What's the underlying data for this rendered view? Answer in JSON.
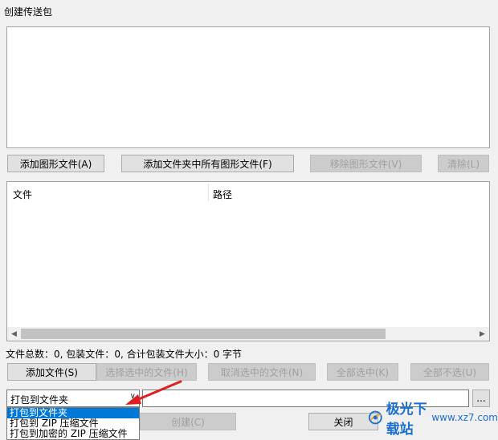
{
  "window": {
    "title": "创建传送包"
  },
  "buttons": {
    "add_graphic": "添加图形文件(A)",
    "add_folder_graphics": "添加文件夹中所有图形文件(F)",
    "remove_graphic": "移除图形文件(V)",
    "clear": "清除(L)",
    "add_file": "添加文件(S)",
    "select_chosen": "选择选中的文件(H)",
    "deselect_chosen": "取消选中的文件(N)",
    "select_all": "全部选中(K)",
    "select_none": "全部不选(U)",
    "create": "创建(C)",
    "close": "关闭",
    "browse": "..."
  },
  "file_list": {
    "columns": [
      "文件",
      "路径"
    ],
    "rows": []
  },
  "summary": {
    "total_label": "文件总数：",
    "total_value": "0",
    "packaged_label": "包装文件：",
    "packaged_value": "0",
    "size_label": "合计包装文件大小：",
    "size_value": "0 字节"
  },
  "package_mode": {
    "selected": "打包到文件夹",
    "options": [
      "打包到文件夹",
      "打包到 ZIP 压缩文件",
      "打包到加密的 ZIP 压缩文件"
    ],
    "highlighted_index": 0
  },
  "output_path": {
    "value": ""
  },
  "watermark": {
    "name": "极光下载站",
    "url": "www.xz7.com"
  },
  "colors": {
    "selection": "#0078d7",
    "annotation_arrow": "#e02020",
    "watermark_blue": "#1b6fd1"
  }
}
